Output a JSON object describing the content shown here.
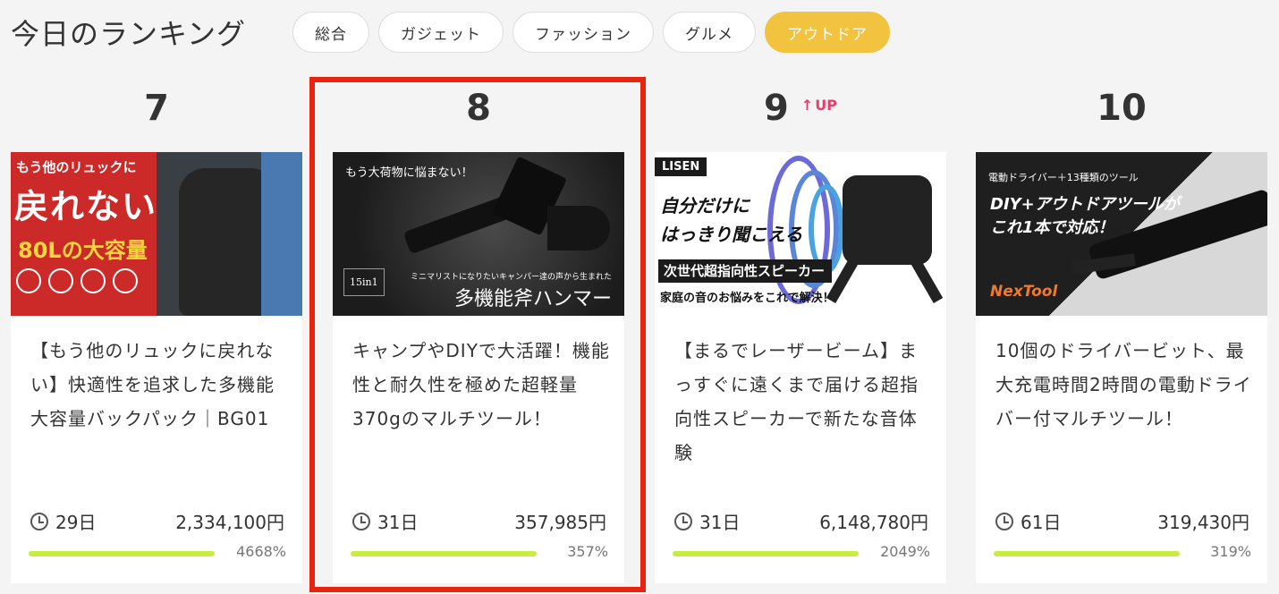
{
  "header": {
    "title": "今日のランキング",
    "tabs": [
      {
        "label": "総合",
        "active": false
      },
      {
        "label": "ガジェット",
        "active": false
      },
      {
        "label": "ファッション",
        "active": false
      },
      {
        "label": "グルメ",
        "active": false
      },
      {
        "label": "アウトドア",
        "active": true
      }
    ]
  },
  "cards": [
    {
      "rank": "7",
      "rank_badge": "",
      "title": "【もう他のリュックに戻れない】快適性を追求した多機能大容量バックパック｜BG01",
      "days": "29日",
      "amount": "2,334,100円",
      "percent": "4668%",
      "thumb": {
        "line1": "もう他のリュックに",
        "line2": "戻れない",
        "line3": "80Lの大容量"
      }
    },
    {
      "rank": "8",
      "rank_badge": "",
      "title": "キャンプやDIYで大活躍！機能性と耐久性を極めた超軽量370gのマルチツール！",
      "days": "31日",
      "amount": "357,985円",
      "percent": "357%",
      "thumb": {
        "tag": "もう大荷物に悩まない！",
        "box": "15in1",
        "sub": "ミニマリストになりたいキャンパー達の声から生まれた",
        "main": "多機能斧ハンマー"
      }
    },
    {
      "rank": "9",
      "rank_badge": "UP",
      "title": "【まるでレーザービーム】まっすぐに遠くまで届ける超指向性スピーカーで新たな音体験",
      "days": "31日",
      "amount": "6,148,780円",
      "percent": "2049%",
      "thumb": {
        "brand": "LISEN",
        "headline_1": "自分だけに",
        "headline_2": "はっきり聞こえる",
        "bar": "次世代超指向性スピーカー",
        "foot": "家庭の音のお悩みをこれで解決！"
      }
    },
    {
      "rank": "10",
      "rank_badge": "",
      "title": "10個のドライバービット、最大充電時間2時間の電動ドライバー付マルチツール！",
      "days": "61日",
      "amount": "319,430円",
      "percent": "319%",
      "thumb": {
        "small": "電動ドライバー＋13種類のツール",
        "headline_1": "DIY+アウトドアツールが",
        "headline_2": "これ1本で対応！",
        "logo": "NexTool"
      }
    }
  ],
  "colors": {
    "accent_tab": "#f2c33e",
    "progress": "#c9ec3f",
    "highlight_border": "#e8230e",
    "rank_up": "#e4406d"
  }
}
